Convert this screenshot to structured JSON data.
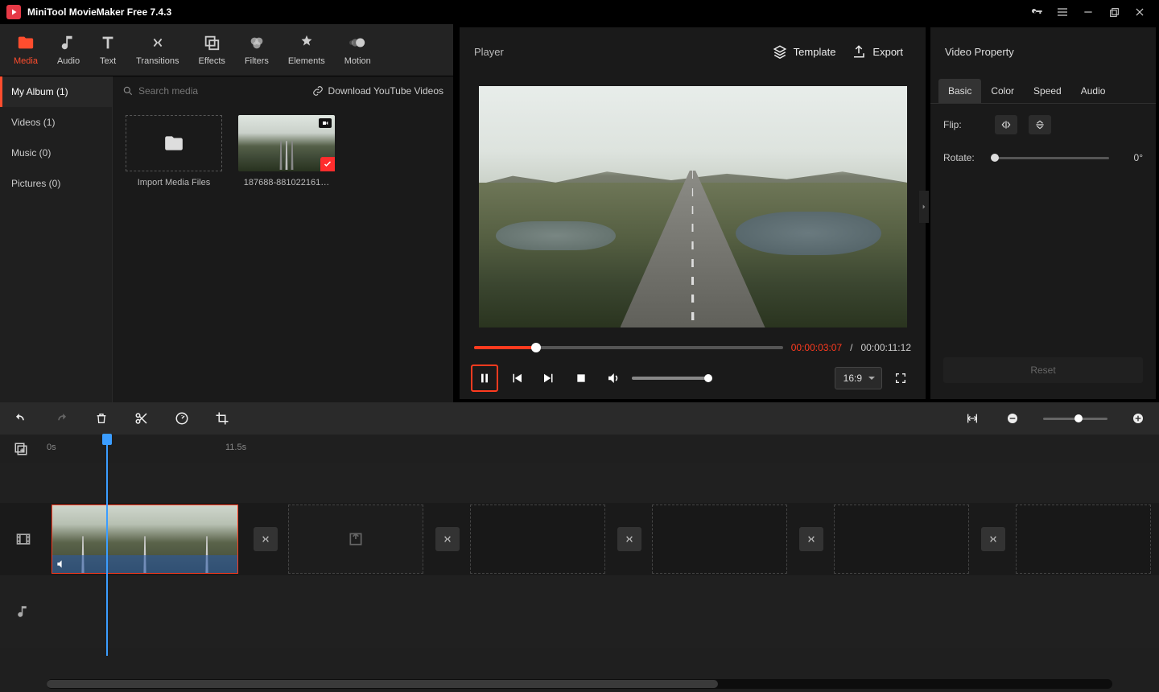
{
  "app": {
    "title": "MiniTool MovieMaker Free 7.4.3"
  },
  "tabs": {
    "media": "Media",
    "audio": "Audio",
    "text": "Text",
    "transitions": "Transitions",
    "effects": "Effects",
    "filters": "Filters",
    "elements": "Elements",
    "motion": "Motion"
  },
  "album": {
    "my_album": "My Album (1)",
    "videos": "Videos (1)",
    "music": "Music (0)",
    "pictures": "Pictures (0)"
  },
  "media": {
    "search_placeholder": "Search media",
    "download_yt": "Download YouTube Videos",
    "import_label": "Import Media Files",
    "clip1_label": "187688-881022161…"
  },
  "player": {
    "title": "Player",
    "template": "Template",
    "export": "Export",
    "time_current": "00:00:03:07",
    "time_separator": " / ",
    "time_total": "00:00:11:12",
    "ratio": "16:9"
  },
  "props": {
    "title": "Video Property",
    "tabs": {
      "basic": "Basic",
      "color": "Color",
      "speed": "Speed",
      "audio": "Audio"
    },
    "flip_label": "Flip:",
    "rotate_label": "Rotate:",
    "rotate_value": "0°",
    "reset": "Reset"
  },
  "timeline": {
    "mark0": "0s",
    "mark1": "11.5s"
  }
}
